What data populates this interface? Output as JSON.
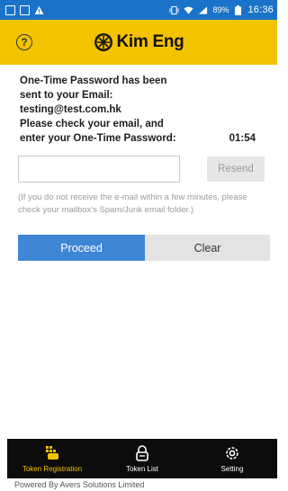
{
  "status_bar": {
    "battery": "89%",
    "time": "16:36",
    "colors": {
      "background": "#1a73c8"
    }
  },
  "header": {
    "brand_name": "Kim Eng",
    "help_glyph": "?",
    "colors": {
      "background": "#f4c300"
    }
  },
  "message": {
    "lines": [
      "One-Time Password has been",
      "sent to your Email:",
      "testing@test.com.hk",
      "Please check your email, and",
      "enter your One-Time Password:"
    ],
    "countdown": "01:54"
  },
  "otp": {
    "value": "",
    "placeholder": "",
    "resend_label": "Resend"
  },
  "note": "(If you do not receive the e-mail within a few minutes, please check your mailbox's Spam/Junk email folder.)",
  "actions": {
    "proceed_label": "Proceed",
    "clear_label": "Clear",
    "colors": {
      "proceed": "#3f86d4",
      "clear": "#e3e3e3"
    }
  },
  "bottom_nav": {
    "items": [
      {
        "label": "Token Registration",
        "icon": "token-registration-icon",
        "active": true
      },
      {
        "label": "Token List",
        "icon": "lock-icon",
        "active": false
      },
      {
        "label": "Setting",
        "icon": "gear-icon",
        "active": false
      }
    ],
    "colors": {
      "background": "#0c0c0c",
      "active": "#f4c300"
    }
  },
  "footer": "Powered By Avers Solutions Limited"
}
